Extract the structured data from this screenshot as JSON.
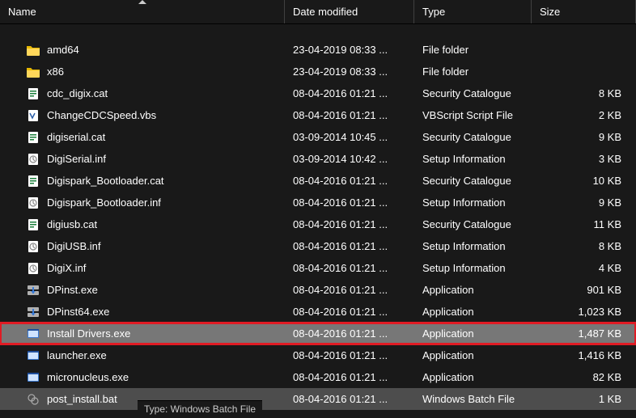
{
  "columns": {
    "name": "Name",
    "date": "Date modified",
    "type": "Type",
    "size": "Size"
  },
  "rows": [
    {
      "icon": "folder",
      "name": "amd64",
      "date": "23-04-2019 08:33 ...",
      "type": "File folder",
      "size": ""
    },
    {
      "icon": "folder",
      "name": "x86",
      "date": "23-04-2019 08:33 ...",
      "type": "File folder",
      "size": ""
    },
    {
      "icon": "cat",
      "name": "cdc_digix.cat",
      "date": "08-04-2016 01:21 ...",
      "type": "Security Catalogue",
      "size": "8 KB"
    },
    {
      "icon": "vbs",
      "name": "ChangeCDCSpeed.vbs",
      "date": "08-04-2016 01:21 ...",
      "type": "VBScript Script File",
      "size": "2 KB"
    },
    {
      "icon": "cat",
      "name": "digiserial.cat",
      "date": "03-09-2014 10:45 ...",
      "type": "Security Catalogue",
      "size": "9 KB"
    },
    {
      "icon": "inf",
      "name": "DigiSerial.inf",
      "date": "03-09-2014 10:42 ...",
      "type": "Setup Information",
      "size": "3 KB"
    },
    {
      "icon": "cat",
      "name": "Digispark_Bootloader.cat",
      "date": "08-04-2016 01:21 ...",
      "type": "Security Catalogue",
      "size": "10 KB"
    },
    {
      "icon": "inf",
      "name": "Digispark_Bootloader.inf",
      "date": "08-04-2016 01:21 ...",
      "type": "Setup Information",
      "size": "9 KB"
    },
    {
      "icon": "cat",
      "name": "digiusb.cat",
      "date": "08-04-2016 01:21 ...",
      "type": "Security Catalogue",
      "size": "11 KB"
    },
    {
      "icon": "inf",
      "name": "DigiUSB.inf",
      "date": "08-04-2016 01:21 ...",
      "type": "Setup Information",
      "size": "8 KB"
    },
    {
      "icon": "inf",
      "name": "DigiX.inf",
      "date": "08-04-2016 01:21 ...",
      "type": "Setup Information",
      "size": "4 KB"
    },
    {
      "icon": "exe-installer",
      "name": "DPinst.exe",
      "date": "08-04-2016 01:21 ...",
      "type": "Application",
      "size": "901 KB"
    },
    {
      "icon": "exe-installer",
      "name": "DPinst64.exe",
      "date": "08-04-2016 01:21 ...",
      "type": "Application",
      "size": "1,023 KB"
    },
    {
      "icon": "exe",
      "name": "Install Drivers.exe",
      "date": "08-04-2016 01:21 ...",
      "type": "Application",
      "size": "1,487 KB",
      "highlight": true
    },
    {
      "icon": "exe",
      "name": "launcher.exe",
      "date": "08-04-2016 01:21 ...",
      "type": "Application",
      "size": "1,416 KB"
    },
    {
      "icon": "exe",
      "name": "micronucleus.exe",
      "date": "08-04-2016 01:21 ...",
      "type": "Application",
      "size": "82 KB"
    },
    {
      "icon": "bat",
      "name": "post_install.bat",
      "date": "08-04-2016 01:21 ...",
      "type": "Windows Batch File",
      "size": "1 KB",
      "hover": true
    }
  ],
  "tooltip": "Type: Windows Batch File"
}
